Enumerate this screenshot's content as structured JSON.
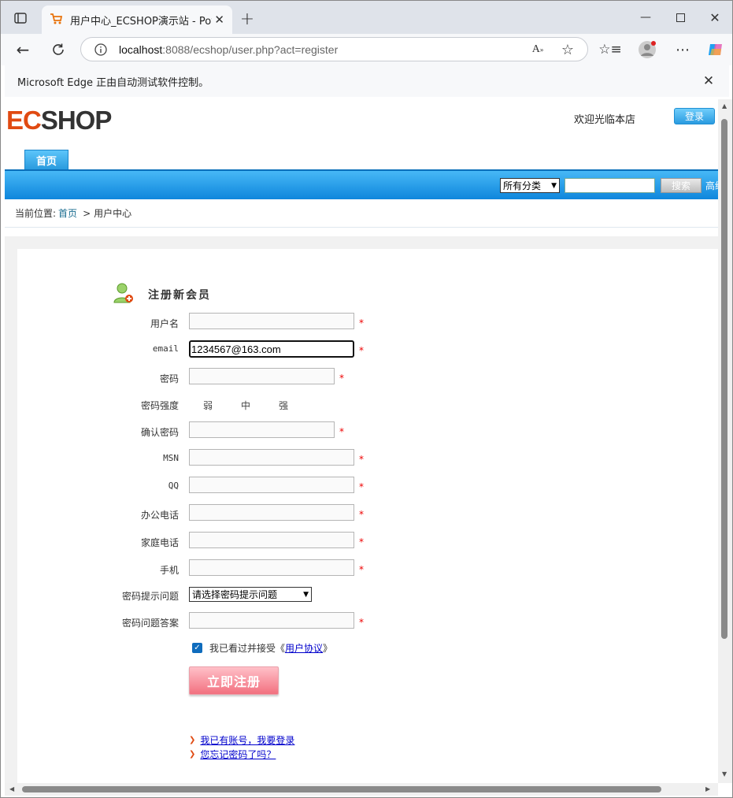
{
  "browser": {
    "tab_title": "用户中心_ECSHOP演示站 - Powered",
    "url_host": "localhost",
    "url_rest": ":8088/ecshop/user.php?act=register",
    "infobar_text": "Microsoft Edge 正由自动测试软件控制。"
  },
  "site": {
    "logo_ec": "EC",
    "logo_rest": "SHOP",
    "welcome": "欢迎光临本店",
    "login_button": "登录",
    "nav_home": "首页",
    "category_select": "所有分类",
    "search_button": "搜索",
    "advanced_search": "高级搜索"
  },
  "breadcrumb": {
    "prefix": "当前位置:",
    "home": "首页",
    "sep": ">",
    "current": "用户中心"
  },
  "form": {
    "title": "注册新会员",
    "labels": {
      "username": "用户名",
      "email": "email",
      "password": "密码",
      "strength": "密码强度",
      "confirm": "确认密码",
      "msn": "MSN",
      "qq": "QQ",
      "office_phone": "办公电话",
      "home_phone": "家庭电话",
      "mobile": "手机",
      "question": "密码提示问题",
      "answer": "密码问题答案"
    },
    "email_value": "1234567@163.com",
    "strength_levels": {
      "weak": "弱",
      "medium": "中",
      "strong": "强"
    },
    "required_mark": "*",
    "question_select": "请选择密码提示问题",
    "agree_prefix": "我已看过并接受《",
    "agree_link": "用户协议",
    "agree_suffix": "》",
    "submit": "立即注册",
    "link_login": "我已有账号，我要登录",
    "link_forgot": "您忘记密码了吗？"
  }
}
